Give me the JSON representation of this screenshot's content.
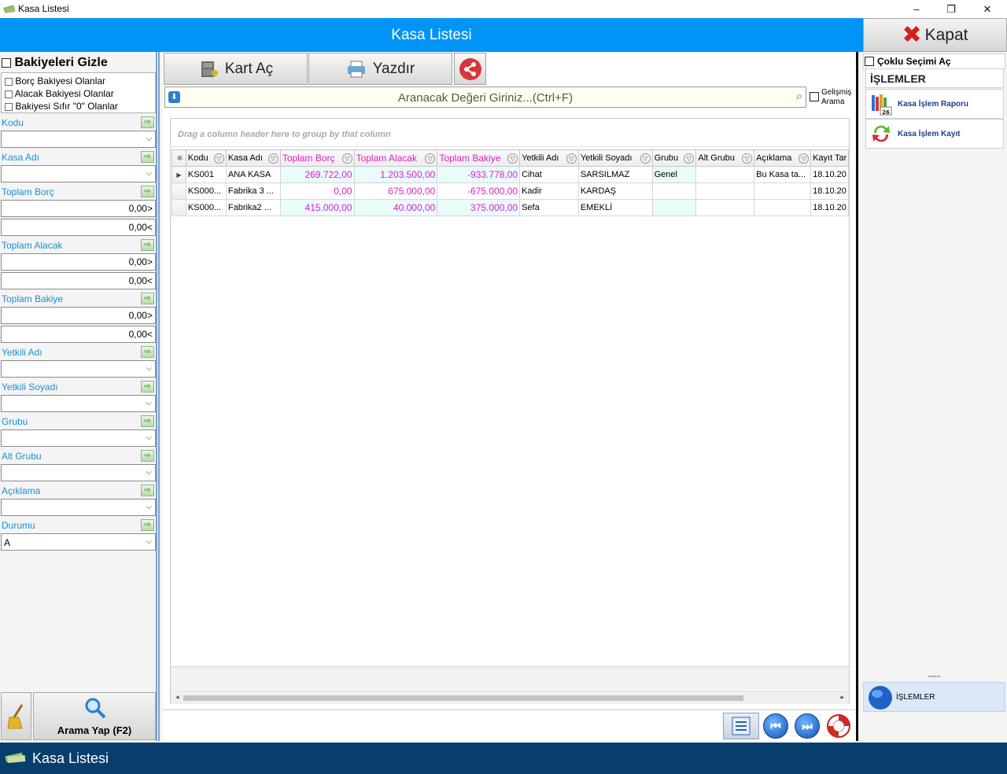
{
  "window": {
    "title": "Kasa Listesi",
    "minimize": "–",
    "restore": "❐",
    "close": "✕"
  },
  "header": {
    "title": "Kasa Listesi",
    "close_label": "Kapat"
  },
  "left": {
    "hide_balances": "Bakiyeleri Gizle",
    "options": [
      "Borç Bakiyesi Olanlar",
      "Alacak Bakiyesi Olanlar",
      "Bakiyesi Sıfır \"0\" Olanlar"
    ],
    "kodu": "Kodu",
    "kasa_adi": "Kasa Adı",
    "toplam_borc": "Toplam Borç",
    "toplam_borc_min": "0,00>",
    "toplam_borc_max": "0,00<",
    "toplam_alacak": "Toplam Alacak",
    "toplam_alacak_min": "0,00>",
    "toplam_alacak_max": "0,00<",
    "toplam_bakiye": "Toplam Bakiye",
    "toplam_bakiye_min": "0,00>",
    "toplam_bakiye_max": "0,00<",
    "yetkili_adi": "Yetkili Adı",
    "yetkili_soyadi": "Yetkili Soyadı",
    "grubu": "Grubu",
    "alt_grubu": "Alt Grubu",
    "aciklama": "Açıklama",
    "durumu": "Durumu",
    "durumu_value": "A",
    "search_button": "Arama Yap (F2)"
  },
  "toolbar": {
    "open_card": "Kart Aç",
    "print": "Yazdır"
  },
  "search": {
    "placeholder": "Aranacak Değeri Giriniz...(Ctrl+F)",
    "advanced": "Gelişmiş Arama"
  },
  "grid": {
    "group_hint": "Drag a column header here to group by that column",
    "columns": [
      "Kodu",
      "Kasa Adı",
      "Toplam Borç",
      "Toplam Alacak",
      "Toplam Bakiye",
      "Yetkili Adı",
      "Yetkili Soyadı",
      "Grubu",
      "Alt Grubu",
      "Açıklama",
      "Kayıt Tar"
    ],
    "rows": [
      [
        "KS001",
        "ANA KASA",
        "269.722,00",
        "1.203.500,00",
        "-933.778,00",
        "Cihat",
        "SARSILMAZ",
        "Genel",
        "",
        "Bu Kasa ta...",
        "18.10.20"
      ],
      [
        "KS000...",
        "Fabrika 3 ...",
        "0,00",
        "675.000,00",
        "-675.000,00",
        "Kadir",
        "KARDAŞ",
        "",
        "",
        "",
        "18.10.20"
      ],
      [
        "KS000...",
        "Fabrika2 ...",
        "415.000,00",
        "40.000,00",
        "375.000,00",
        "Sefa",
        "EMEKLİ",
        "",
        "",
        "",
        "18.10.20"
      ]
    ]
  },
  "right": {
    "multi_select": "Çoklu Seçimi Aç",
    "operations_title": "İŞLEMLER",
    "items": [
      "Kasa İşlem Raporu",
      "Kasa İşlem Kayıt"
    ],
    "section_label": "İŞLEMLER",
    "grip": "''''''''''"
  },
  "bottom": {
    "title": "Kasa Listesi"
  }
}
